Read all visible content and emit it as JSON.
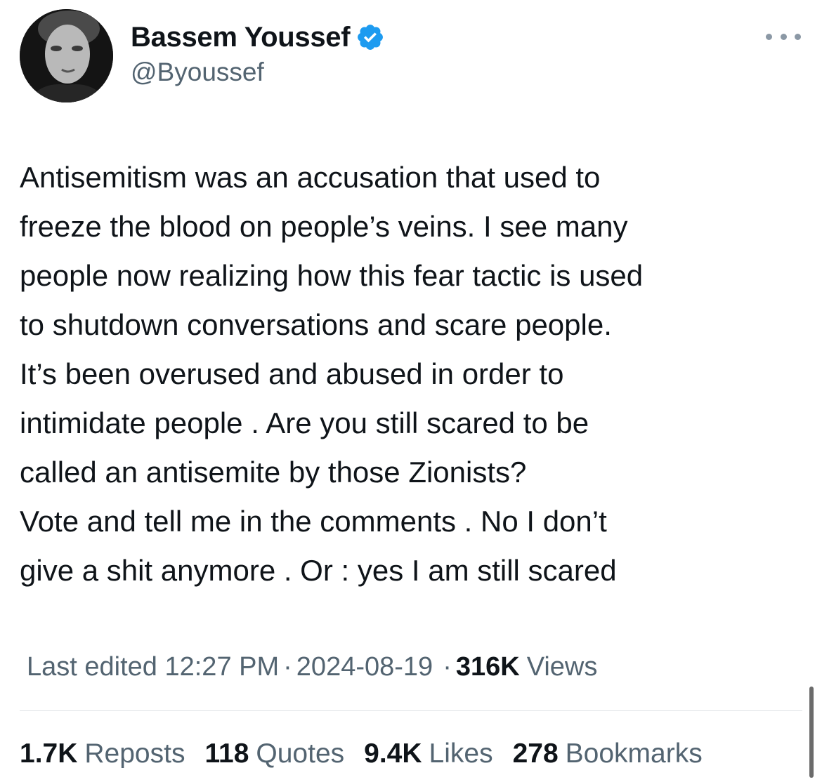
{
  "author": {
    "display_name": "Bassem Youssef",
    "handle": "@Byoussef",
    "verified_icon": "verified-badge-icon",
    "verified_color": "#1d9bf0",
    "avatar_icon": "profile-photo"
  },
  "more_icon": "more-options-icon",
  "tweet": {
    "lines": [
      "Antisemitism was an accusation that used to",
      "freeze the blood on people’s veins. I see many",
      "people now realizing how this fear tactic is used",
      "to shutdown conversations and scare people.",
      "It’s been overused and abused in order to",
      "intimidate people . Are you still scared to be",
      "called an antisemite by those Zionists?",
      "Vote and tell me in the comments . No I don’t",
      "give a shit anymore . Or : yes I am still scared"
    ]
  },
  "meta": {
    "edited_label": "Last edited",
    "time": "12:27 PM",
    "separator": "·",
    "date": "2024-08-19",
    "views_count": "316K",
    "views_label": "Views"
  },
  "stats": [
    {
      "count": "1.7K",
      "label": "Reposts"
    },
    {
      "count": "118",
      "label": "Quotes"
    },
    {
      "count": "9.4K",
      "label": "Likes"
    },
    {
      "count": "278",
      "label": "Bookmarks"
    }
  ],
  "colors": {
    "text": "#0f1419",
    "secondary": "#536471",
    "accent": "#1d9bf0",
    "divider": "#e1e5e8"
  }
}
